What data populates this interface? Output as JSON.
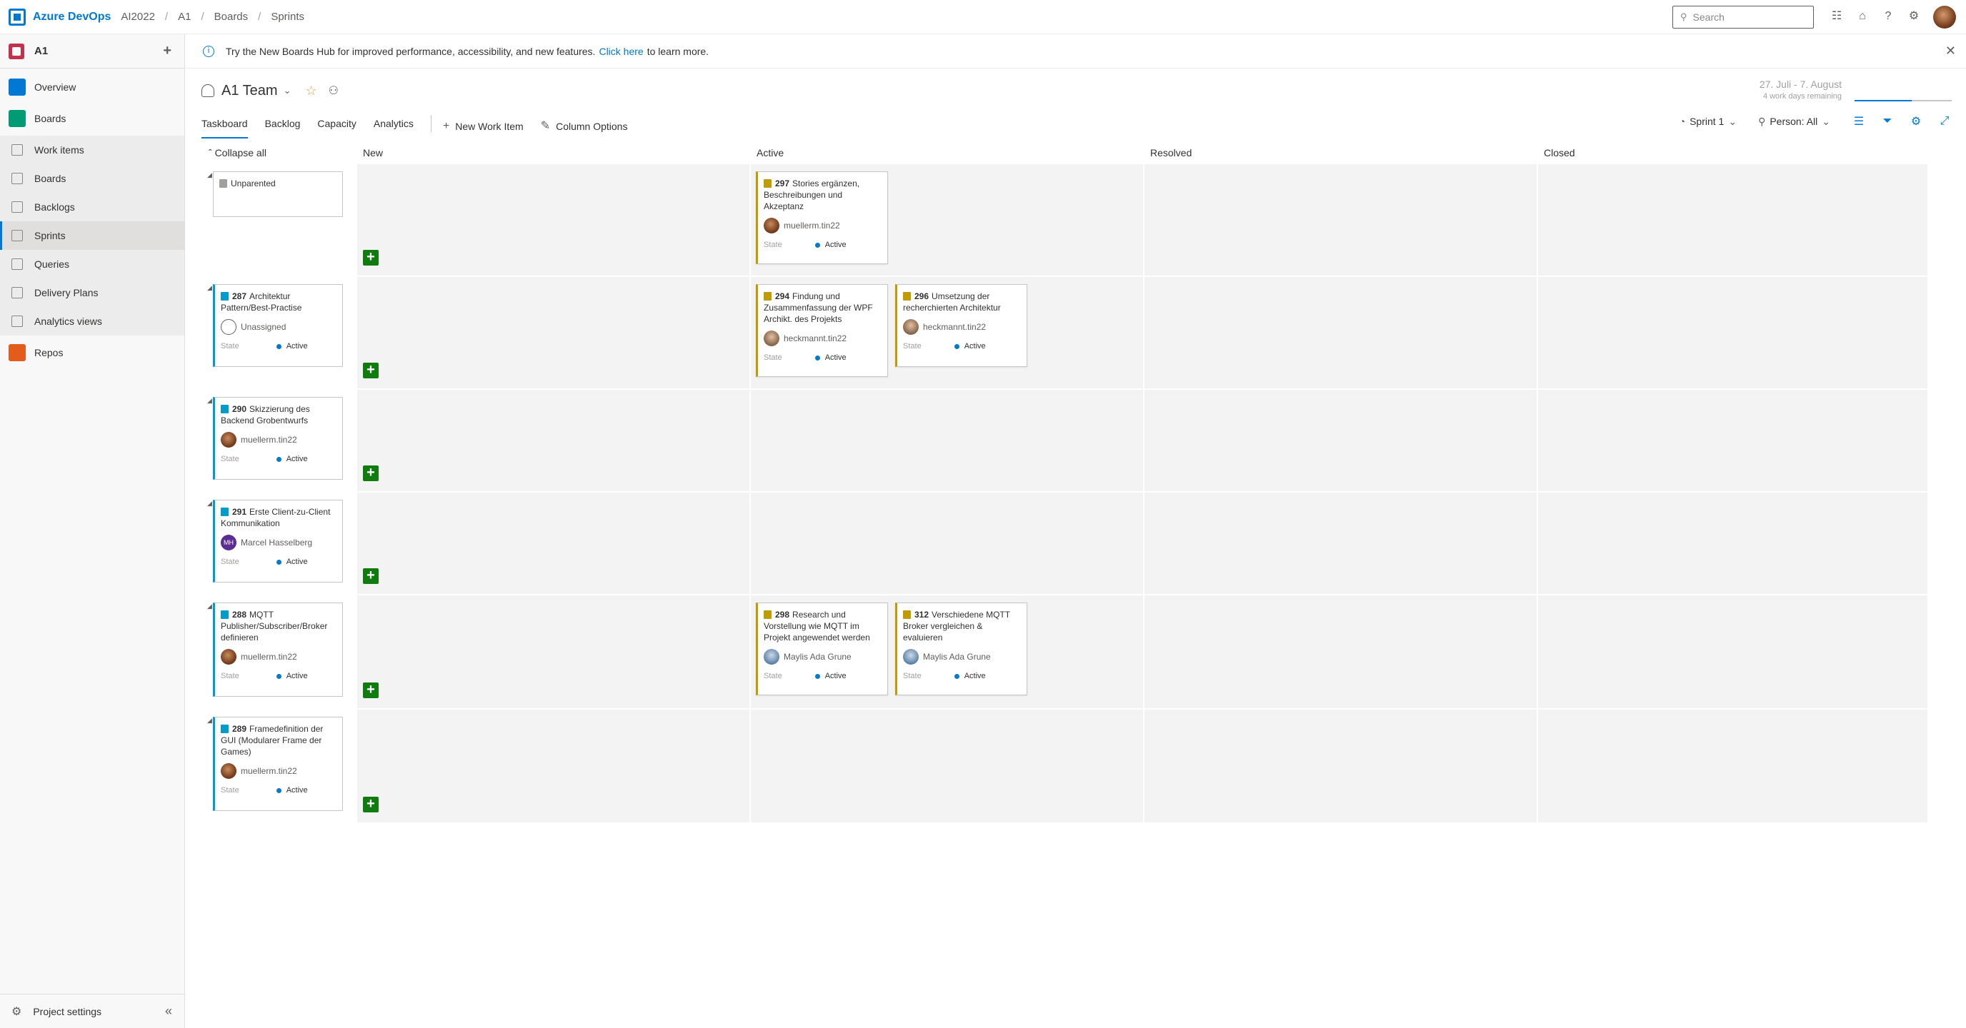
{
  "topbar": {
    "brand": "Azure DevOps",
    "org": "AI2022",
    "crumbs": [
      "A1",
      "Boards",
      "Sprints"
    ],
    "search_placeholder": "Search"
  },
  "sidebar": {
    "project": "A1",
    "items": [
      {
        "label": "Overview",
        "color": "#0078d4"
      },
      {
        "label": "Boards",
        "color": "#009b74"
      }
    ],
    "board_items": [
      "Work items",
      "Boards",
      "Backlogs",
      "Sprints",
      "Queries",
      "Delivery Plans",
      "Analytics views"
    ],
    "repos": {
      "label": "Repos",
      "color": "#e35c1c"
    },
    "settings": "Project settings"
  },
  "banner": {
    "text": "Try the New Boards Hub for improved performance, accessibility, and new features.",
    "link": "Click here",
    "suffix": "to learn more."
  },
  "header": {
    "team": "A1 Team",
    "date_range": "27. Juli - 7. August",
    "remaining": "4 work days remaining"
  },
  "tabs": [
    "Taskboard",
    "Backlog",
    "Capacity",
    "Analytics"
  ],
  "toolbar": {
    "new_item": "New Work Item",
    "column_options": "Column Options",
    "sprint": "Sprint 1",
    "person": "Person: All"
  },
  "board": {
    "collapse_all": "Collapse all",
    "columns": [
      "New",
      "Active",
      "Resolved",
      "Closed"
    ],
    "state_label": "State",
    "rows": [
      {
        "parent": {
          "id": "",
          "title": "Unparented",
          "assignee": "",
          "state": ""
        },
        "active": [
          {
            "id": "297",
            "title": "Stories ergänzen, Beschreibungen und Akzeptanz",
            "assignee": "muellerm.tin22",
            "state": "Active"
          }
        ]
      },
      {
        "parent": {
          "id": "287",
          "title": "Architektur Pattern/Best-Practise",
          "assignee": "Unassigned",
          "state": "Active"
        },
        "active": [
          {
            "id": "294",
            "title": "Findung und Zusammenfassung der WPF Archikt. des Projekts",
            "assignee": "heckmannt.tin22",
            "state": "Active"
          },
          {
            "id": "296",
            "title": "Umsetzung der recherchierten Architektur",
            "assignee": "heckmannt.tin22",
            "state": "Active"
          }
        ]
      },
      {
        "parent": {
          "id": "290",
          "title": "Skizzierung des Backend Grobentwurfs",
          "assignee": "muellerm.tin22",
          "state": "Active"
        },
        "active": []
      },
      {
        "parent": {
          "id": "291",
          "title": "Erste Client-zu-Client Kommunikation",
          "assignee": "Marcel Hasselberg",
          "initials": "MH",
          "state": "Active"
        },
        "active": []
      },
      {
        "parent": {
          "id": "288",
          "title": "MQTT Publisher/Subscriber/Broker definieren",
          "assignee": "muellerm.tin22",
          "state": "Active"
        },
        "active": [
          {
            "id": "298",
            "title": "Research und Vorstellung wie MQTT im Projekt angewendet werden",
            "assignee": "Maylis Ada Grune",
            "state": "Active"
          },
          {
            "id": "312",
            "title": "Verschiedene MQTT Broker vergleichen & evaluieren",
            "assignee": "Maylis Ada Grune",
            "state": "Active"
          }
        ]
      },
      {
        "parent": {
          "id": "289",
          "title": "Framedefinition der GUI (Modularer Frame der Games)",
          "assignee": "muellerm.tin22",
          "state": "Active"
        },
        "active": []
      }
    ]
  }
}
